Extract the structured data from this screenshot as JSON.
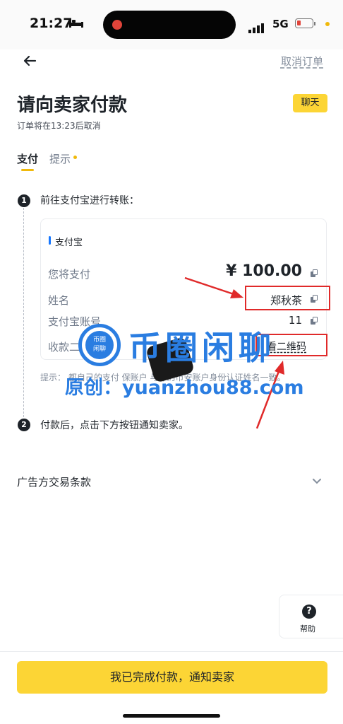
{
  "status_bar": {
    "time": "21:27",
    "network": "5G"
  },
  "header": {
    "back_icon": "arrow-left-icon",
    "cancel_label": "取消订单",
    "title": "请向卖家付款",
    "chat_label": "聊天",
    "subtitle": "订单将在13:23后取消"
  },
  "tabs": [
    {
      "label": "支付",
      "active": true
    },
    {
      "label": "提示",
      "active": false,
      "has_dot": true
    }
  ],
  "steps": [
    {
      "number": "1",
      "text": "前往支付宝进行转账："
    },
    {
      "number": "2",
      "text": "付款后，点击下方按钮通知卖家。"
    }
  ],
  "payment_card": {
    "method": "支付宝",
    "rows": [
      {
        "label": "您将支付",
        "value": "¥ 100.00"
      },
      {
        "label": "姓名",
        "value": "郑秋茶"
      },
      {
        "label": "支付宝账号",
        "value": "11"
      },
      {
        "label": "收款二",
        "value": "看二维码"
      }
    ]
  },
  "hint": "提示：        都自己的支付        保账户        与你的币安账户身份认证姓名一致。",
  "ad_terms_label": "广告方交易条款",
  "help_label": "帮助",
  "confirm_button": "我已完成付款，通知卖家",
  "watermark": {
    "badge_line1": "币圈",
    "badge_line2": "闲聊",
    "title": "币圈闲聊",
    "subtitle": "原创：yuanzhou88.com"
  },
  "colors": {
    "accent": "#fcd535",
    "annotation": "#e02a2a",
    "watermark": "#2a7de1"
  }
}
